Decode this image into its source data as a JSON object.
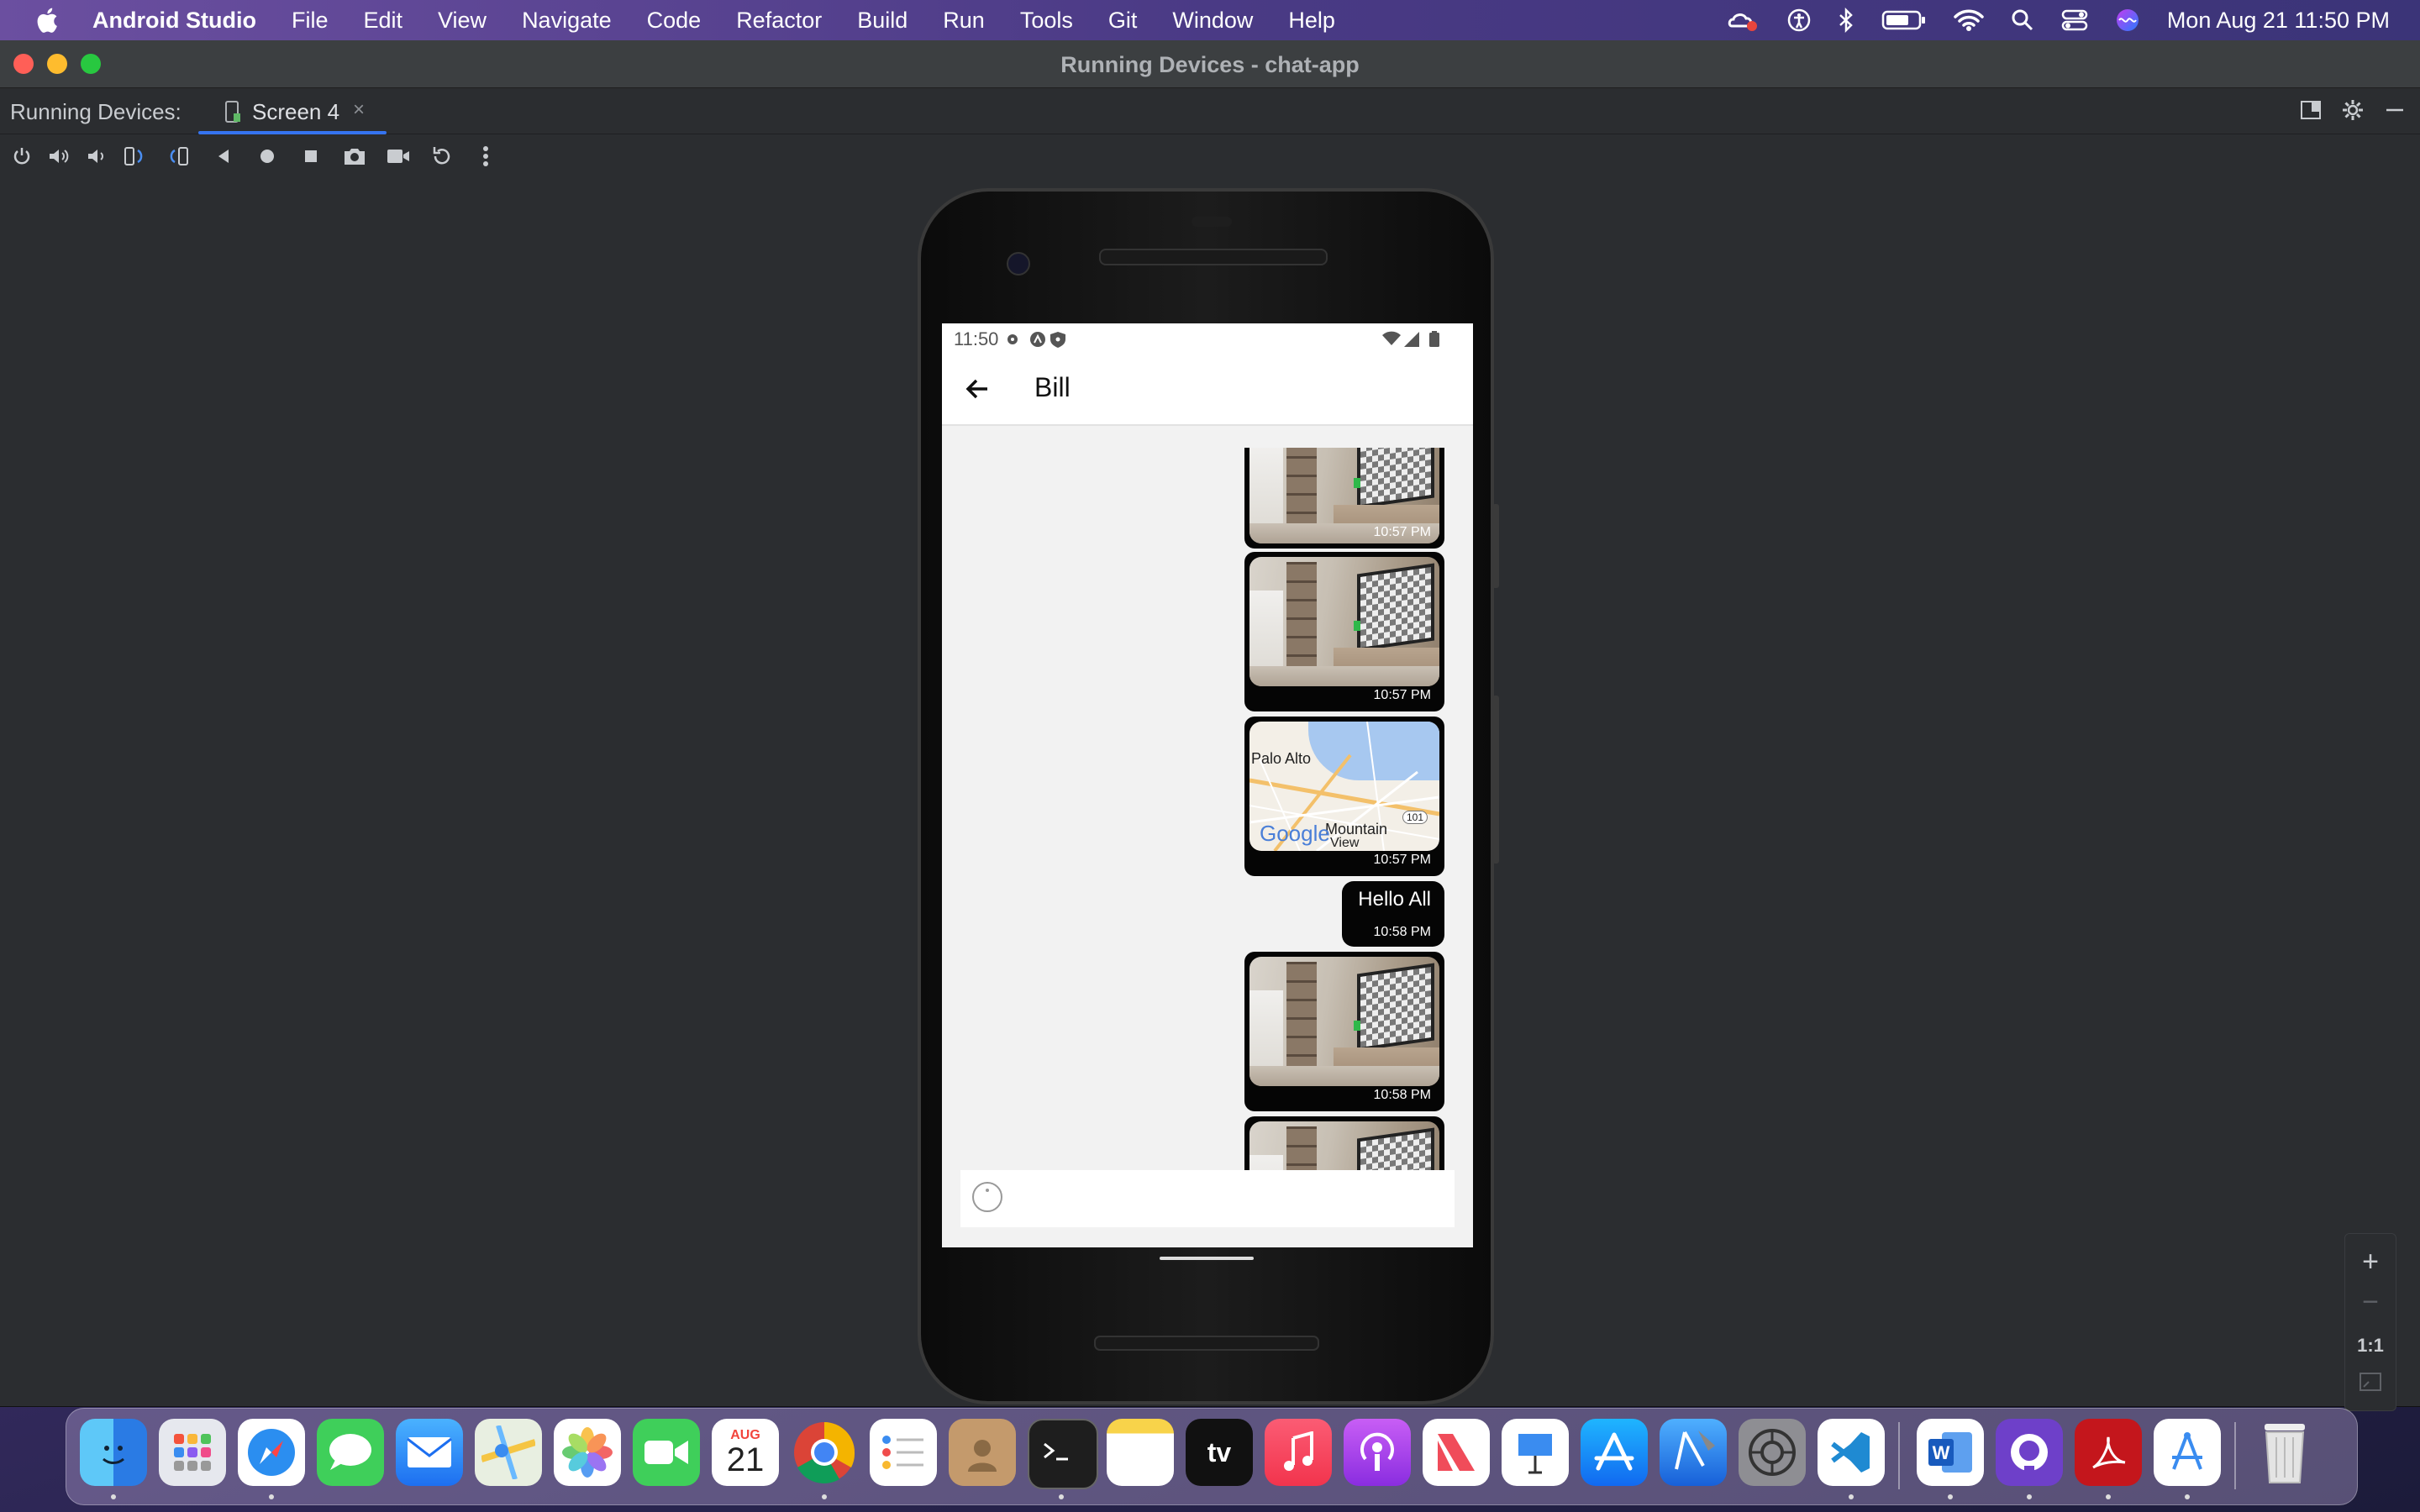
{
  "menubar": {
    "app_name": "Android Studio",
    "items": [
      "File",
      "Edit",
      "View",
      "Navigate",
      "Code",
      "Refactor",
      "Build",
      "Run",
      "Tools",
      "Git",
      "Window",
      "Help"
    ],
    "clock": "Mon Aug 21  11:50 PM"
  },
  "window": {
    "title": "Running Devices - chat-app",
    "tool_label": "Running Devices:",
    "tab_label": "Screen 4",
    "tab_close": "×"
  },
  "toolbar_icons": [
    "power-icon",
    "volume-up-icon",
    "volume-down-icon",
    "rotate-left-icon",
    "rotate-right-icon",
    "back-icon",
    "home-icon",
    "overview-icon",
    "screenshot-icon",
    "screen-record-icon",
    "reset-icon",
    "more-icon"
  ],
  "zoom": {
    "plus": "+",
    "minus": "−",
    "actual": "1:1"
  },
  "phone": {
    "status_time": "11:50",
    "chat_title": "Bill",
    "messages": [
      {
        "kind": "image",
        "time": "10:57 PM"
      },
      {
        "kind": "image",
        "time": "10:57 PM"
      },
      {
        "kind": "map",
        "time": "10:57 PM",
        "labels": [
          "Palo Alto",
          "Mountain",
          "View",
          "101",
          "Google"
        ]
      },
      {
        "kind": "text",
        "text": "Hello All",
        "time": "10:58 PM"
      },
      {
        "kind": "image",
        "time": "10:58 PM"
      },
      {
        "kind": "image",
        "time": ""
      }
    ]
  },
  "dock": {
    "apps": [
      "Finder",
      "Launchpad",
      "Safari",
      "Messages",
      "Mail",
      "Maps",
      "Photos",
      "FaceTime",
      "Calendar",
      "Chrome",
      "Reminders",
      "Contacts",
      "Terminal",
      "Notes",
      "TV",
      "Music",
      "Podcasts",
      "News",
      "Keynote",
      "App Store",
      "Xcode",
      "System Settings",
      "VS Code",
      "Word",
      "GitHub Desktop",
      "Acrobat",
      "Android Studio",
      "Trash"
    ],
    "calendar_month": "AUG",
    "calendar_day": "21",
    "tv_label": "tv"
  },
  "colors": {
    "accent": "#3574f0",
    "bubble": "#050505",
    "chat_bg": "#f2f2f2"
  }
}
